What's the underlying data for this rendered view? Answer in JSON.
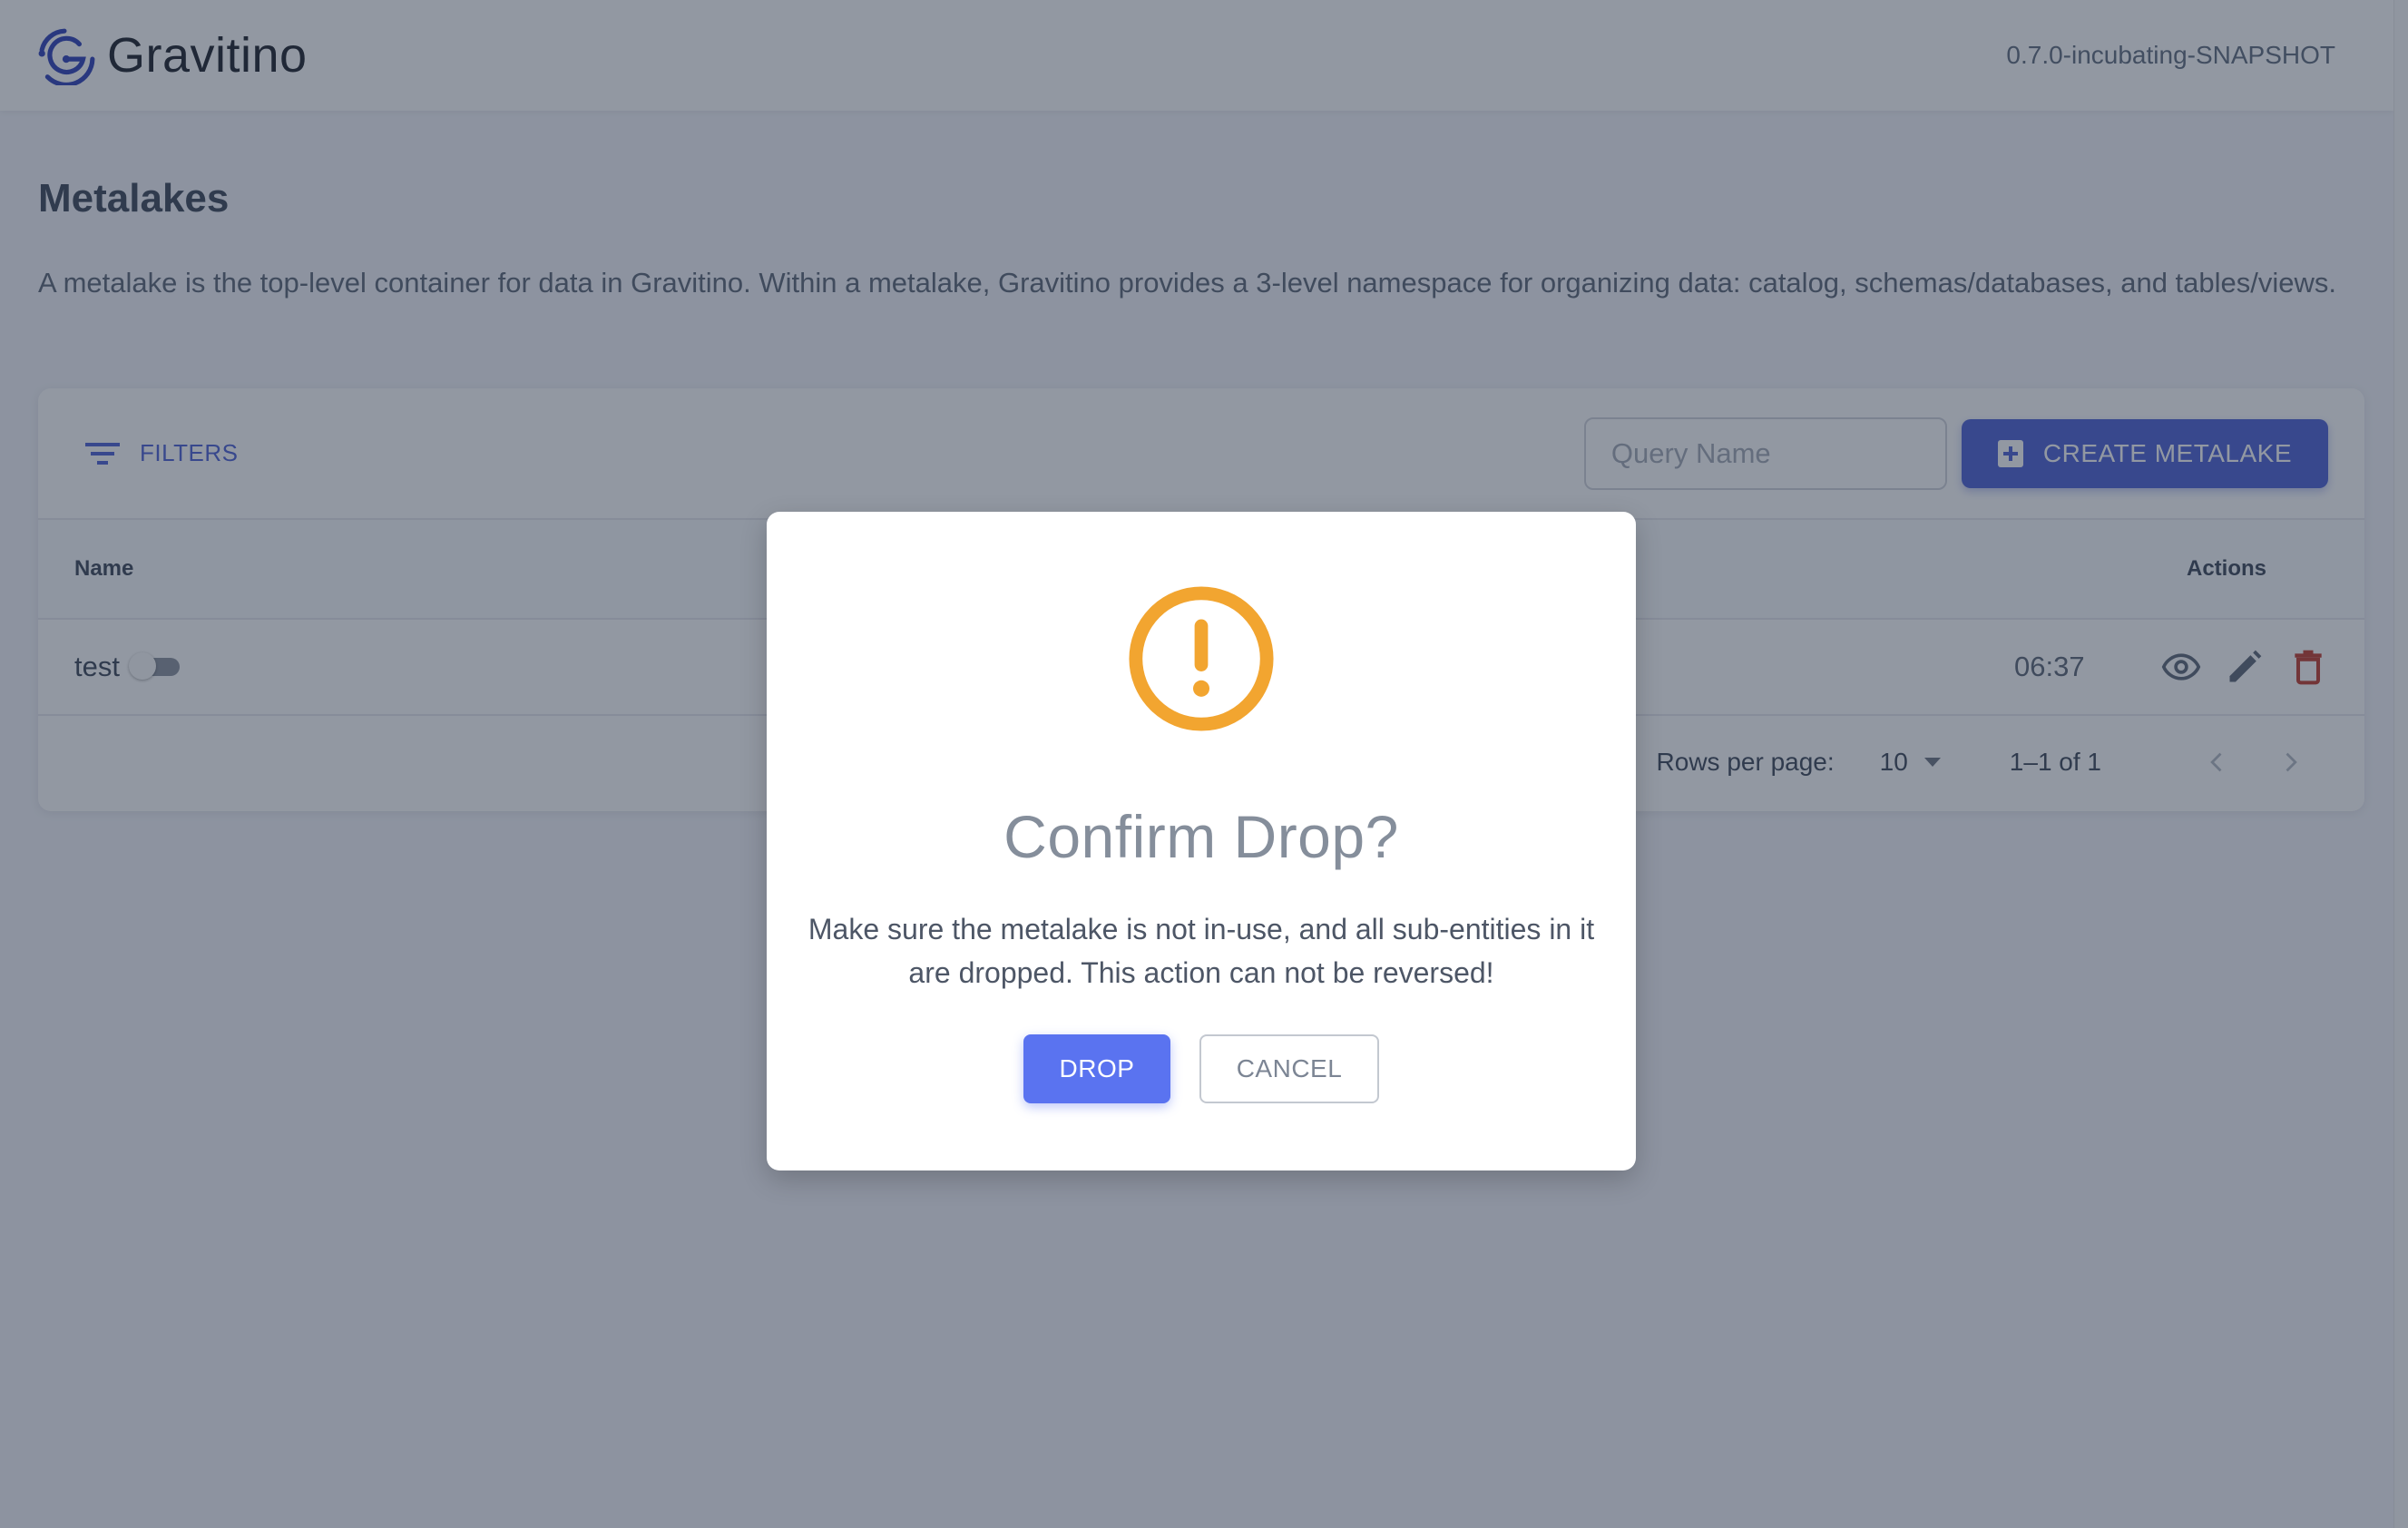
{
  "header": {
    "brand": "Gravitino",
    "version": "0.7.0-incubating-SNAPSHOT"
  },
  "page": {
    "title": "Metalakes",
    "description": "A metalake is the top-level container for data in Gravitino. Within a metalake, Gravitino provides a 3-level namespace for organizing data: catalog, schemas/databases, and tables/views."
  },
  "toolbar": {
    "filters_label": "FILTERS",
    "search_placeholder": "Query Name",
    "search_value": "",
    "create_label": "CREATE METALAKE"
  },
  "table": {
    "columns": [
      "Name",
      "Actions"
    ],
    "rows": [
      {
        "name": "test",
        "in_use": false,
        "time_visible_fragment": "06:37"
      }
    ]
  },
  "pagination": {
    "rows_per_page_label": "Rows per page:",
    "rows_per_page": "10",
    "range": "1–1 of 1"
  },
  "modal": {
    "icon": "alert-circle-icon",
    "title": "Confirm Drop?",
    "body": "Make sure the metalake is not in-use, and all sub-entities in it are dropped. This action can not be reversed!",
    "confirm_label": "DROP",
    "cancel_label": "CANCEL"
  },
  "colors": {
    "brand": "#2c3fb8",
    "primary": "#4a5fd4",
    "drop_button": "#5a73f0",
    "warning": "#f2a530",
    "danger": "#c0392b",
    "overlay": "rgba(38,50,70,0.5)"
  }
}
